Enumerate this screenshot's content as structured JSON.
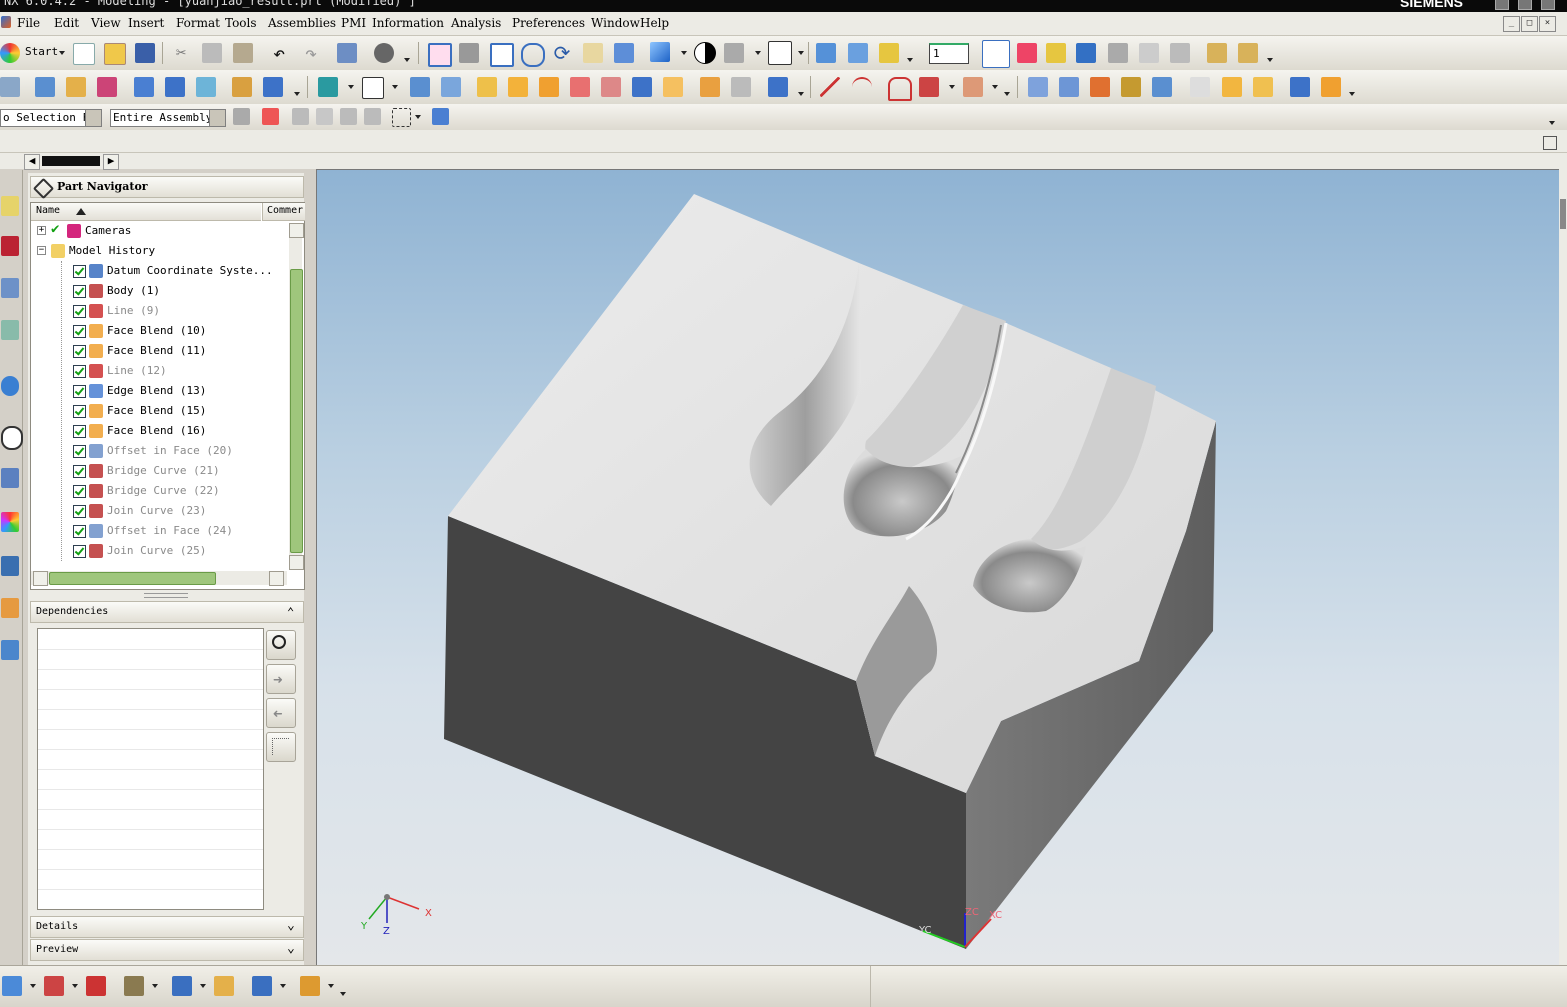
{
  "window": {
    "title": "NX 6.0.4.2 - Modeling - [yuanjiao_result.prt (Modified) ]",
    "brand": "SIEMENS"
  },
  "menu": {
    "items": [
      "File",
      "Edit",
      "View",
      "Insert",
      "Format",
      "Tools",
      "Assemblies",
      "PMI",
      "Information",
      "Analysis",
      "Preferences",
      "Window",
      "Help"
    ]
  },
  "toolbar": {
    "start_label": "Start",
    "layer_value": "1"
  },
  "selection": {
    "filter_value": "o Selection Fi",
    "scope_value": "Entire Assembly"
  },
  "navigator": {
    "title": "Part Navigator",
    "col_name": "Name",
    "col_comment": "Commer",
    "rows": [
      {
        "label": "Cameras",
        "dim": false
      },
      {
        "label": "Model History",
        "dim": false
      },
      {
        "label": "Datum Coordinate Syste...",
        "dim": false
      },
      {
        "label": "Body (1)",
        "dim": false
      },
      {
        "label": "Line (9)",
        "dim": true
      },
      {
        "label": "Face Blend (10)",
        "dim": false
      },
      {
        "label": "Face Blend (11)",
        "dim": false
      },
      {
        "label": "Line (12)",
        "dim": true
      },
      {
        "label": "Edge Blend (13)",
        "dim": false
      },
      {
        "label": "Face Blend (15)",
        "dim": false
      },
      {
        "label": "Face Blend (16)",
        "dim": false
      },
      {
        "label": "Offset in Face (20)",
        "dim": true
      },
      {
        "label": "Bridge Curve (21)",
        "dim": true
      },
      {
        "label": "Bridge Curve (22)",
        "dim": true
      },
      {
        "label": "Join Curve (23)",
        "dim": true
      },
      {
        "label": "Offset in Face (24)",
        "dim": true
      },
      {
        "label": "Join Curve (25)",
        "dim": true
      }
    ],
    "dependencies_label": "Dependencies",
    "details_label": "Details",
    "preview_label": "Preview"
  },
  "viewport": {
    "triad": {
      "x": "X",
      "y": "Y",
      "z": "Z"
    },
    "wcs": {
      "xc": "XC",
      "yc": "YC",
      "zc": "ZC"
    }
  },
  "colors": {
    "viewport_top": "#8fb3d3",
    "viewport_bottom": "#e4e7ea",
    "check_green": "#11a011"
  }
}
